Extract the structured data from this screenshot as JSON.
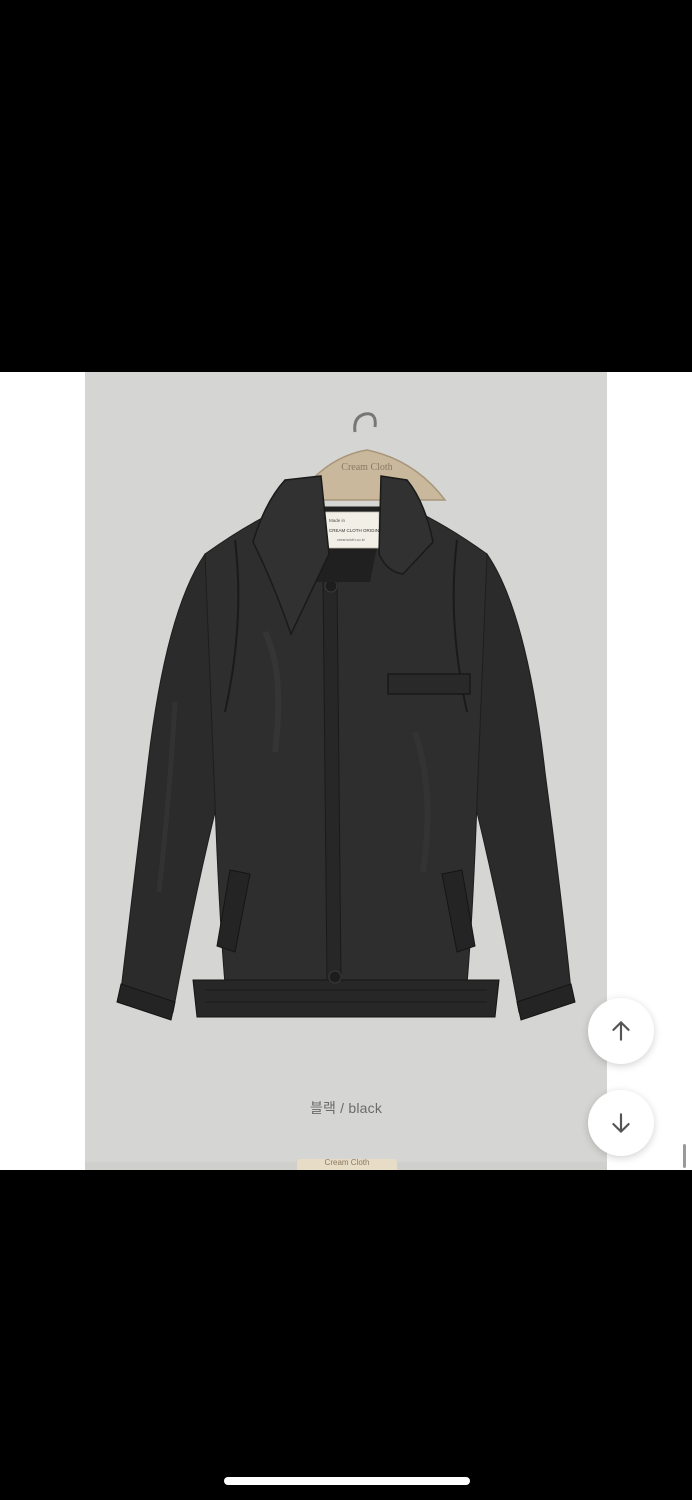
{
  "product": {
    "color_caption": "블랙 / black",
    "hanger_brand": "Cream Cloth",
    "label_lines": [
      "Made in",
      "CREAM CLOTH ORIGINAL",
      "creamcloth.co.kr"
    ],
    "next_item_tag": "Cream Cloth"
  },
  "controls": {
    "scroll_up_icon": "arrow-up-icon",
    "scroll_down_icon": "arrow-down-icon"
  },
  "colors": {
    "background_frame": "#000000",
    "photo_background": "#d5d5d3",
    "jacket": "#2a2b2a"
  }
}
